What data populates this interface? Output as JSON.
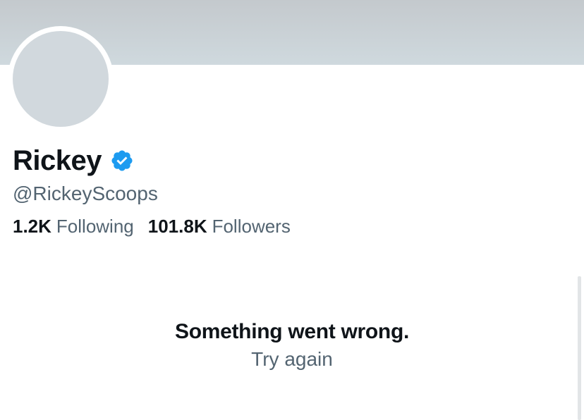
{
  "profile": {
    "display_name": "Rickey",
    "handle": "@RickeyScoops",
    "verified_icon": "verified-badge-icon",
    "following_count": "1.2K",
    "following_label": "Following",
    "followers_count": "101.8K",
    "followers_label": "Followers"
  },
  "error": {
    "title": "Something went wrong.",
    "retry_label": "Try again"
  },
  "colors": {
    "banner": "#cfd9de",
    "avatar_placeholder": "#d1d8dd",
    "verified_blue": "#1d9bf0",
    "text_primary": "#0f1419",
    "text_secondary": "#536471"
  }
}
